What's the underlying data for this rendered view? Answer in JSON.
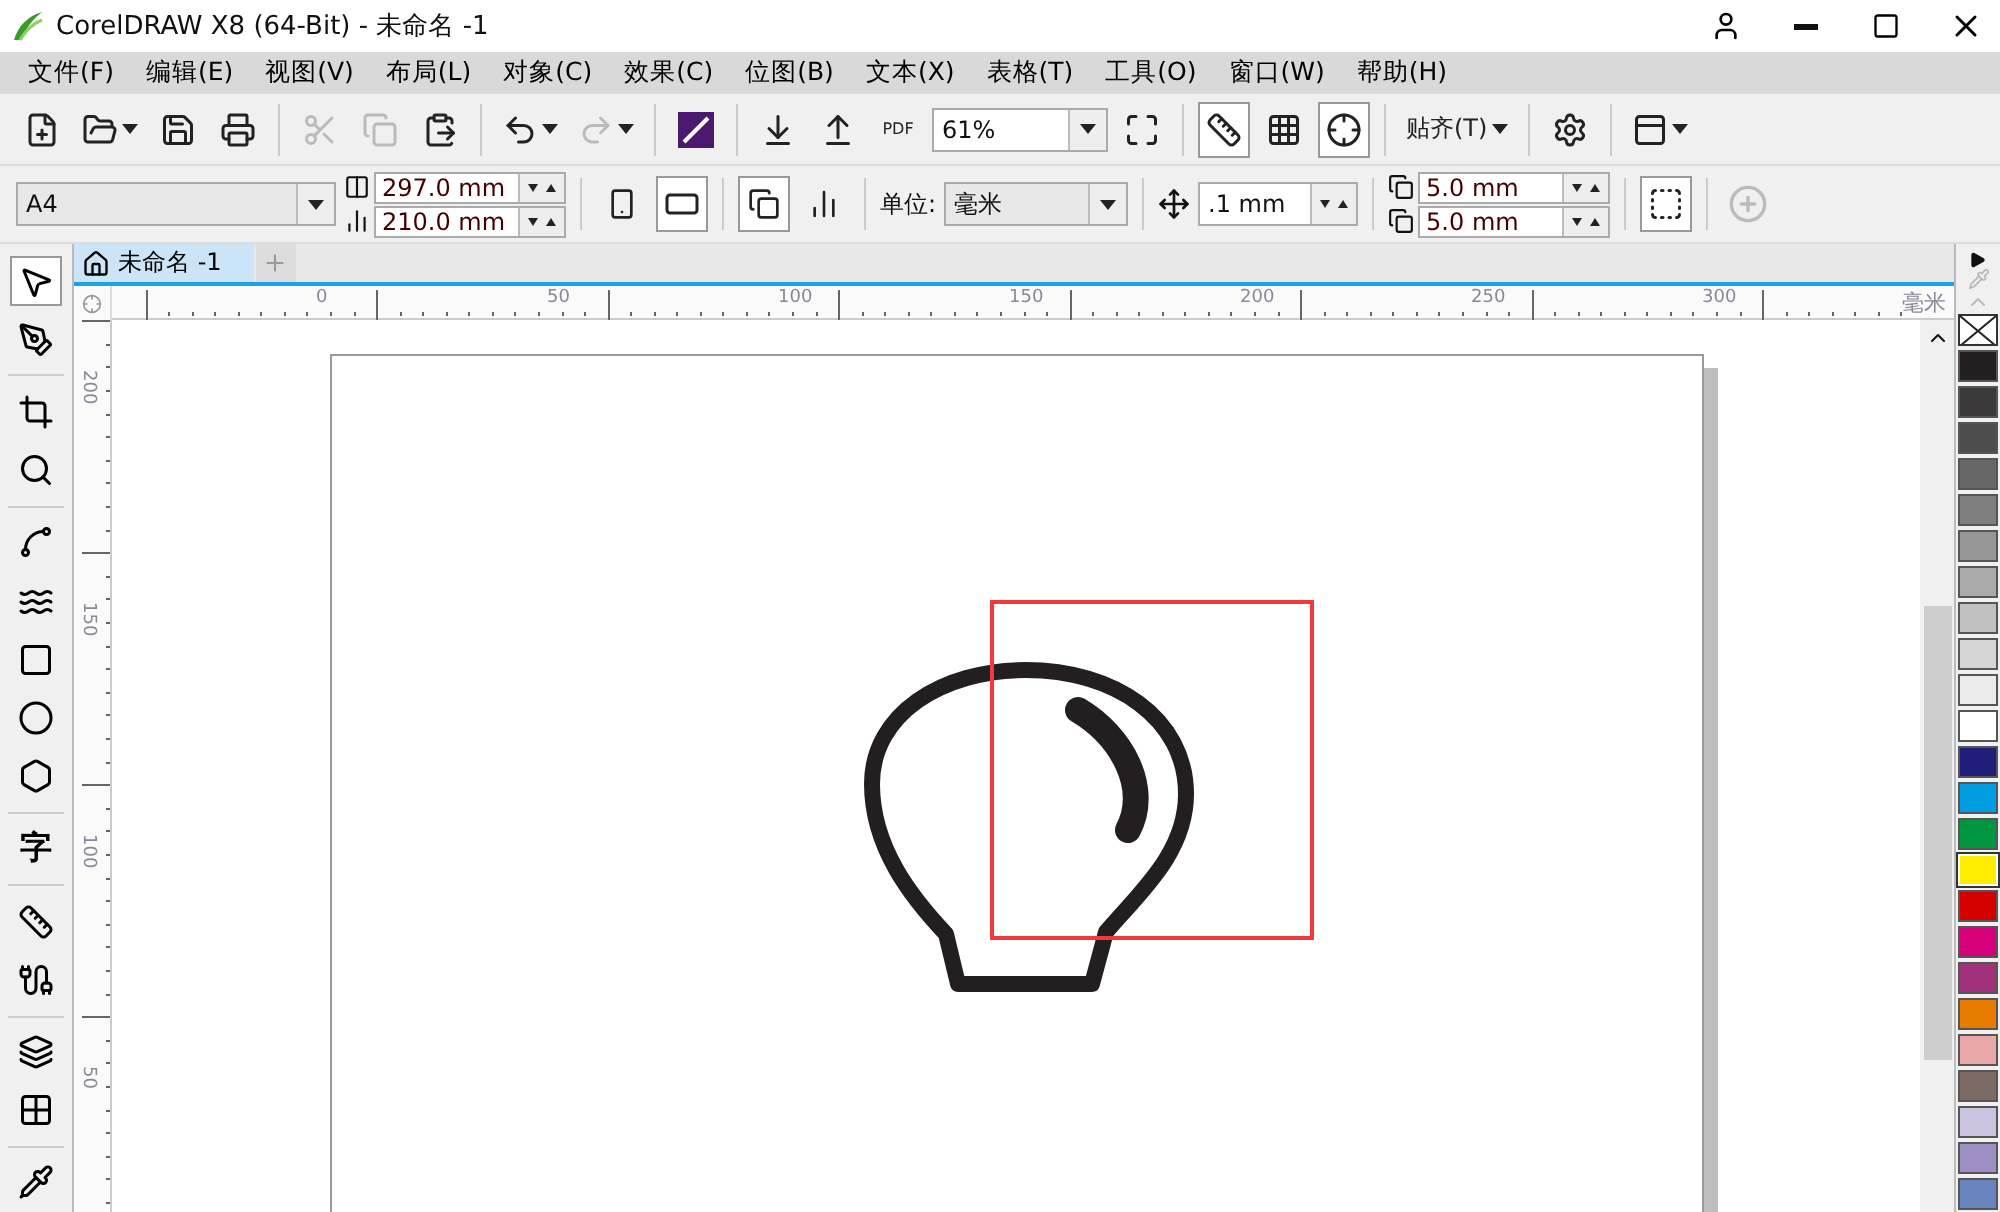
{
  "window": {
    "title": "CorelDRAW X8 (64-Bit) - 未命名 -1"
  },
  "menu": [
    "文件(F)",
    "编辑(E)",
    "视图(V)",
    "布局(L)",
    "对象(C)",
    "效果(C)",
    "位图(B)",
    "文本(X)",
    "表格(T)",
    "工具(O)",
    "窗口(W)",
    "帮助(H)"
  ],
  "toolbar": [
    {
      "kind": "new",
      "disabled": false
    },
    {
      "kind": "open",
      "disabled": false
    },
    {
      "kind": "save",
      "disabled": false
    },
    {
      "kind": "print",
      "disabled": false
    },
    {
      "kind": "separator"
    },
    {
      "kind": "cut",
      "disabled": true
    },
    {
      "kind": "copy",
      "disabled": true
    },
    {
      "kind": "paste",
      "disabled": false
    },
    {
      "kind": "separator"
    },
    {
      "kind": "undo",
      "disabled": false
    },
    {
      "kind": "redo",
      "disabled": true
    },
    {
      "kind": "separator"
    },
    {
      "kind": "connect",
      "disabled": false
    },
    {
      "kind": "separator"
    },
    {
      "kind": "import",
      "disabled": false
    },
    {
      "kind": "export",
      "disabled": false
    },
    {
      "kind": "pdf",
      "label": "PDF",
      "disabled": false
    },
    {
      "kind": "zoom",
      "value": "61%"
    },
    {
      "kind": "fullscreen",
      "disabled": false
    },
    {
      "kind": "separator"
    },
    {
      "kind": "rulers",
      "on": true
    },
    {
      "kind": "grid",
      "on": false
    },
    {
      "kind": "guidelines",
      "on": true
    },
    {
      "kind": "separator"
    },
    {
      "kind": "snap",
      "label": "贴齐(T)"
    },
    {
      "kind": "separator"
    },
    {
      "kind": "settings",
      "disabled": false
    },
    {
      "kind": "separator"
    },
    {
      "kind": "launcher",
      "disabled": false
    }
  ],
  "property_bar": {
    "page_size": "A4",
    "width": "297.0 mm",
    "height": "210.0 mm",
    "landscape": true,
    "unit_label": "单位:",
    "unit": "毫米",
    "nudge": ".1 mm",
    "dup_x": "5.0 mm",
    "dup_y": "5.0 mm"
  },
  "tool_groups": [
    [
      {
        "kind": "pick",
        "selected": true
      },
      {
        "kind": "shape",
        "selected": false
      }
    ],
    [
      {
        "kind": "crop",
        "selected": false
      },
      {
        "kind": "zoom",
        "selected": false
      }
    ],
    [
      {
        "kind": "freehand",
        "selected": false
      },
      {
        "kind": "artistic",
        "selected": false
      },
      {
        "kind": "rectangle",
        "selected": false
      },
      {
        "kind": "ellipse",
        "selected": false
      },
      {
        "kind": "polygon",
        "selected": false
      }
    ],
    [
      {
        "kind": "text",
        "label": "字",
        "selected": false
      }
    ],
    [
      {
        "kind": "dimension",
        "selected": false
      },
      {
        "kind": "connector",
        "selected": false
      }
    ],
    [
      {
        "kind": "shadow",
        "selected": false
      },
      {
        "kind": "transparency",
        "selected": false
      }
    ],
    [
      {
        "kind": "eyedropper",
        "selected": false
      }
    ]
  ],
  "document_tab": {
    "label": "未命名 -1",
    "selected": true
  },
  "ruler": {
    "h_labels": [
      "0",
      "50",
      "100",
      "150",
      "200",
      "250",
      "300"
    ],
    "unit": "毫米",
    "v_labels": [
      "200",
      "150",
      "100",
      "50"
    ]
  },
  "palette": [
    {
      "kind": "none",
      "selected": false
    },
    {
      "color": "#231f20",
      "selected": false
    },
    {
      "color": "#3a3838",
      "selected": false
    },
    {
      "color": "#4d4d4d",
      "selected": false
    },
    {
      "color": "#666666",
      "selected": false
    },
    {
      "color": "#7f7f7f",
      "selected": false
    },
    {
      "color": "#969696",
      "selected": false
    },
    {
      "color": "#aaaaaa",
      "selected": false
    },
    {
      "color": "#c0c0c0",
      "selected": false
    },
    {
      "color": "#d6d6d6",
      "selected": false
    },
    {
      "color": "#ebebeb",
      "selected": false
    },
    {
      "color": "#ffffff",
      "selected": false
    },
    {
      "color": "#1f1f7a",
      "selected": false
    },
    {
      "color": "#009ee0",
      "selected": false
    },
    {
      "color": "#009640",
      "selected": false
    },
    {
      "color": "#ffed00",
      "selected": true
    },
    {
      "color": "#d40000",
      "selected": false
    },
    {
      "color": "#d6007a",
      "selected": false
    },
    {
      "color": "#a0307a",
      "selected": false
    },
    {
      "color": "#e87c00",
      "selected": false
    },
    {
      "color": "#eba8a8",
      "selected": false
    },
    {
      "color": "#7b6a61",
      "selected": false
    },
    {
      "color": "#ccc4e0",
      "selected": false
    },
    {
      "color": "#9d8fc4",
      "selected": false
    },
    {
      "color": "#6a84c0",
      "selected": false
    }
  ]
}
